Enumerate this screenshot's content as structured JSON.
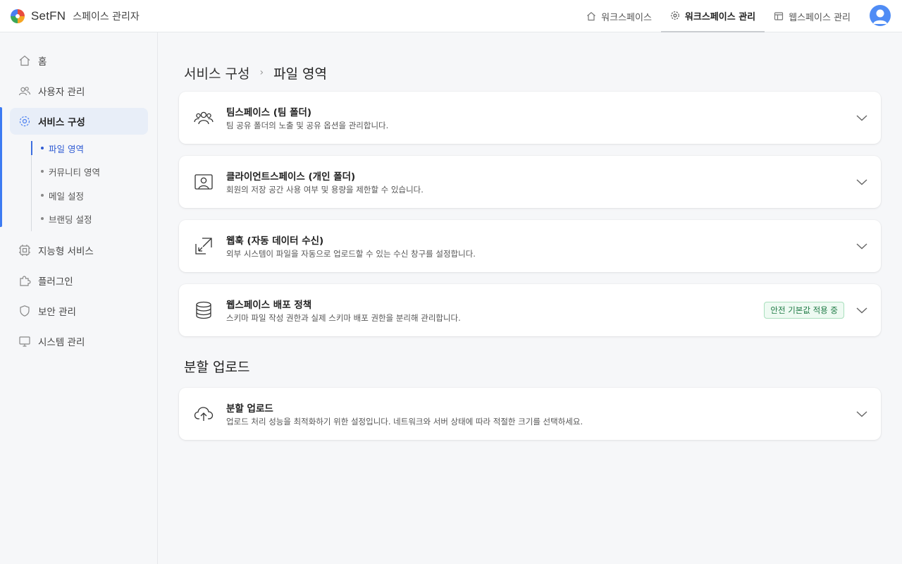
{
  "app": {
    "brand_name": "SetFN",
    "brand_sub": "스페이스 관리자"
  },
  "topnav": {
    "items": [
      {
        "label": "워크스페이스",
        "icon": "home-icon"
      },
      {
        "label": "워크스페이스 관리",
        "icon": "gear-icon",
        "active": true
      },
      {
        "label": "웹스페이스 관리",
        "icon": "layout-icon"
      }
    ]
  },
  "sidebar": {
    "items": [
      {
        "label": "홈",
        "icon": "home-icon"
      },
      {
        "label": "사용자 관리",
        "icon": "users-icon"
      },
      {
        "label": "서비스 구성",
        "icon": "gear-icon",
        "active": true
      },
      {
        "label": "지능형 서비스",
        "icon": "chip-icon"
      },
      {
        "label": "플러그인",
        "icon": "puzzle-icon"
      },
      {
        "label": "보안 관리",
        "icon": "shield-icon"
      },
      {
        "label": "시스템 관리",
        "icon": "monitor-icon"
      }
    ],
    "subitems": [
      {
        "label": "파일 영역",
        "active": true
      },
      {
        "label": "커뮤니티 영역"
      },
      {
        "label": "메일 설정"
      },
      {
        "label": "브랜딩 설정"
      }
    ]
  },
  "breadcrumb": {
    "parent": "서비스 구성",
    "separator": "›",
    "current": "파일 영역"
  },
  "cards": [
    {
      "title": "팀스페이스 (팀 폴더)",
      "desc": "팀 공유 폴더의 노출 및 공유 옵션을 관리합니다.",
      "icon": "team-icon"
    },
    {
      "title": "클라이언트스페이스 (개인 폴더)",
      "desc": "회원의 저장 공간 사용 여부 및 용량을 제한할 수 있습니다.",
      "icon": "person-frame-icon"
    },
    {
      "title": "웹훅 (자동 데이터 수신)",
      "desc": "외부 시스템이 파일을 자동으로 업로드할 수 있는 수신 창구를 설정합니다.",
      "icon": "webhook-arrow-icon"
    },
    {
      "title": "웹스페이스 배포 정책",
      "desc": "스키마 파일 작성 권한과 실제 스키마 배포 권한을 분리해 관리합니다.",
      "icon": "database-icon",
      "badge": "안전 기본값 적용 중"
    }
  ],
  "section2": {
    "title": "분할 업로드",
    "card": {
      "title": "분할 업로드",
      "desc": "업로드 처리 성능을 최적화하기 위한 설정입니다. 네트워크와 서버 상태에 따라 적절한 크기를 선택하세요.",
      "icon": "cloud-upload-icon"
    }
  },
  "colors": {
    "accent": "#3d7bf2",
    "active_sub": "#2f5bd3",
    "badge_text": "#1f7a45",
    "badge_bg": "#eefaf2"
  }
}
